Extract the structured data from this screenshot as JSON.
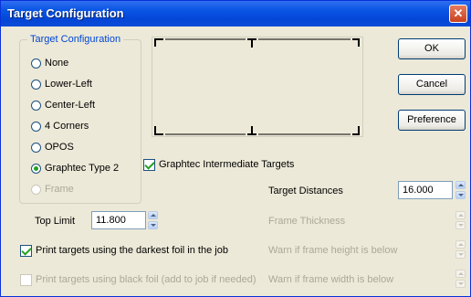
{
  "window": {
    "title": "Target Configuration",
    "close_glyph": "✕"
  },
  "group": {
    "legend": "Target Configuration",
    "options": [
      {
        "label": "None",
        "checked": false,
        "enabled": true
      },
      {
        "label": "Lower-Left",
        "checked": false,
        "enabled": true
      },
      {
        "label": "Center-Left",
        "checked": false,
        "enabled": true
      },
      {
        "label": "4 Corners",
        "checked": false,
        "enabled": true
      },
      {
        "label": "OPOS",
        "checked": false,
        "enabled": true
      },
      {
        "label": "Graphtec Type 2",
        "checked": true,
        "enabled": true
      },
      {
        "label": "Frame",
        "checked": false,
        "enabled": false
      }
    ]
  },
  "buttons": {
    "ok": "OK",
    "cancel": "Cancel",
    "preference": "Preference"
  },
  "graphtec_intermediate": {
    "label": "Graphtec Intermediate Targets",
    "checked": true
  },
  "target_distances": {
    "label": "Target Distances",
    "value": "16.000"
  },
  "top_limit": {
    "label": "Top Limit",
    "value": "11.800"
  },
  "frame_thickness": {
    "label": "Frame Thickness"
  },
  "darkest_foil": {
    "label": "Print targets using the darkest foil in the job",
    "checked": true
  },
  "black_foil": {
    "label": "Print targets using black foil (add to job if needed)",
    "checked": false
  },
  "warn_height": {
    "label": "Warn if frame height is below"
  },
  "warn_width": {
    "label": "Warn if frame width is below"
  }
}
